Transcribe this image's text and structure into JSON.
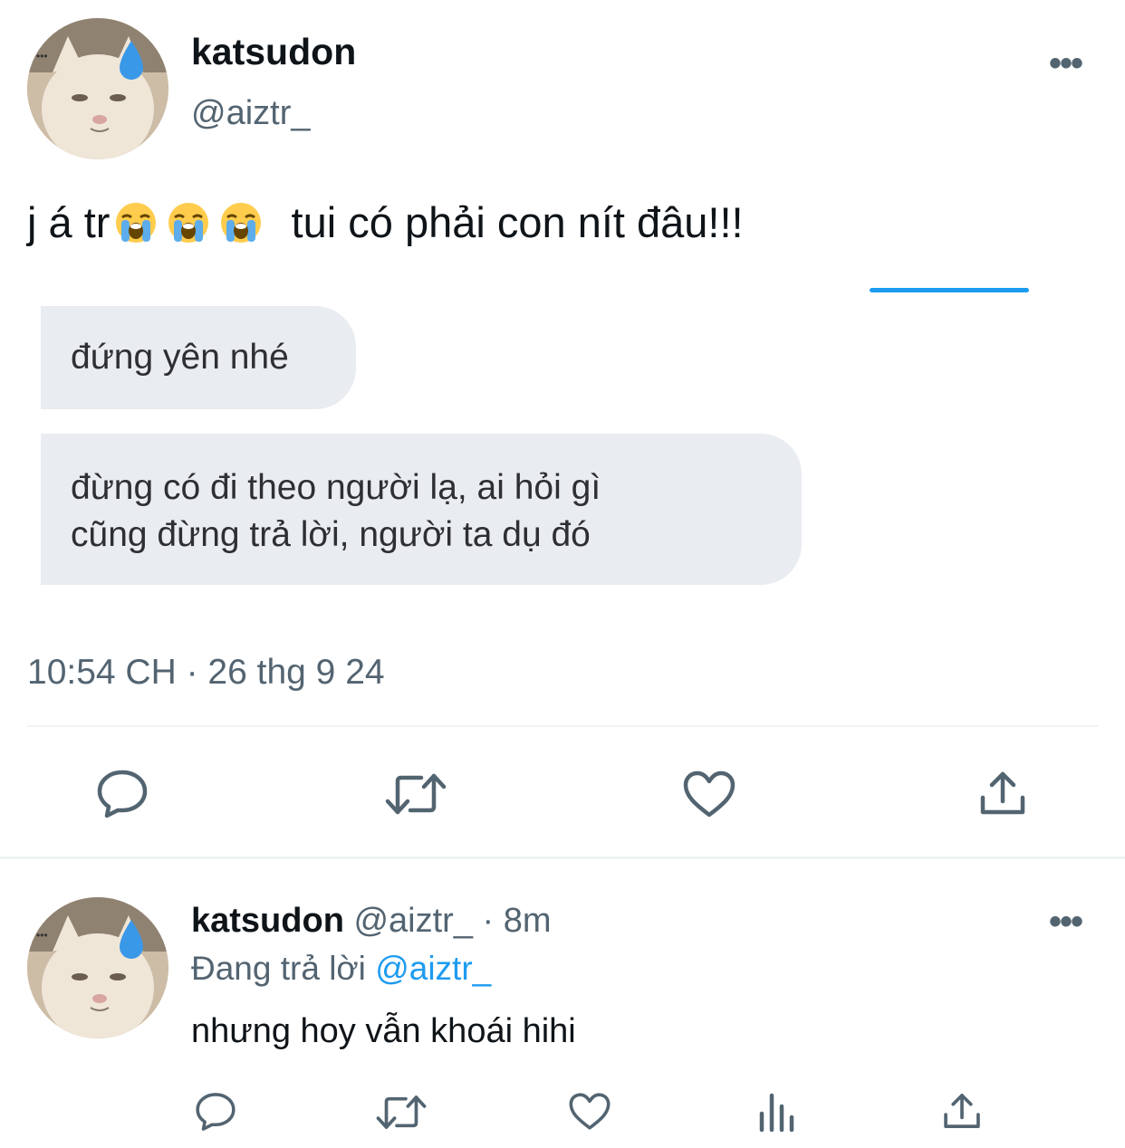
{
  "main_tweet": {
    "author_name": "katsudon",
    "author_handle": "@aiztr_",
    "text_before_emoji": "j á tr",
    "emoji_name": "loudly-crying-face-emoji",
    "emoji_count": 3,
    "text_after_emoji": "tui có phải con nít đâu!!!",
    "bubbles": [
      {
        "text": "đứng yên nhé"
      },
      {
        "line1": "đừng có đi theo người lạ, ai hỏi gì",
        "line2": "cũng đừng trả lời, người ta dụ đó"
      }
    ],
    "timestamp": "10:54 CH · 26 thg 9 24",
    "more_label": "•••"
  },
  "actions": {
    "icons": [
      "reply-icon",
      "retweet-icon",
      "like-icon",
      "share-icon"
    ]
  },
  "reply_tweet": {
    "author_name": "katsudon",
    "author_handle": "@aiztr_",
    "time": "· 8m",
    "replying_label": "Đang trả lời",
    "replying_to": "@aiztr_",
    "text": "nhưng hoy vẫn khoái hihi",
    "more_label": "•••",
    "icons": [
      "reply-icon",
      "retweet-icon",
      "like-icon",
      "views-icon",
      "share-icon"
    ]
  },
  "colors": {
    "accent": "#1d9bf0",
    "secondary_text": "#536471",
    "bubble_bg": "#e9ecf1"
  }
}
